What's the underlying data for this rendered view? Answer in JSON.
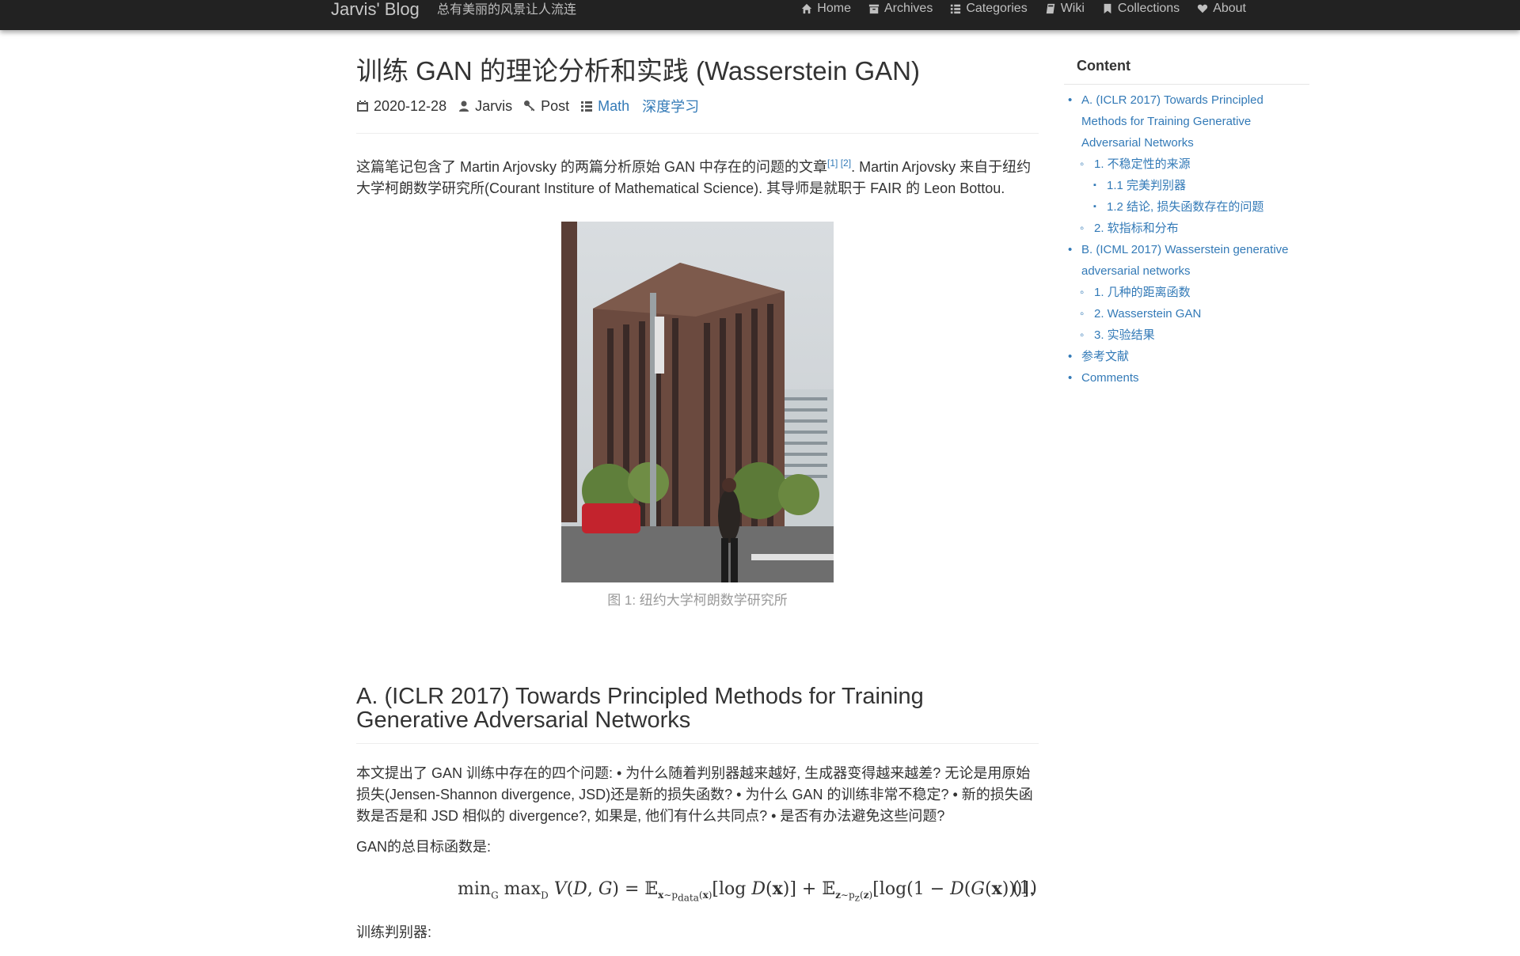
{
  "nav": {
    "brand": "Jarvis' Blog",
    "tagline": "总有美丽的风景让人流连",
    "items": [
      {
        "label": "Home",
        "icon": "home-icon"
      },
      {
        "label": "Archives",
        "icon": "archive-icon"
      },
      {
        "label": "Categories",
        "icon": "list-icon"
      },
      {
        "label": "Wiki",
        "icon": "book-icon"
      },
      {
        "label": "Collections",
        "icon": "bookmark-icon"
      },
      {
        "label": "About",
        "icon": "heart-icon"
      }
    ]
  },
  "post": {
    "title": "训练 GAN 的理论分析和实践 (Wasserstein GAN)",
    "date": "2020-12-28",
    "author": "Jarvis",
    "type": "Post",
    "categories": [
      "Math",
      "深度学习"
    ],
    "intro_text": "这篇笔记包含了 Martin Arjovsky 的两篇分析原始 GAN 中存在的问题的文章",
    "intro_refs": "[1] [2]",
    "intro_text_2": ". Martin Arjovsky 来自于纽约大学柯朗数学研究所(Courant Institure of Mathematical Science). 其导师是就职于 FAIR 的 Leon Bottou.",
    "figure_caption": "图 1: 纽约大学柯朗数学研究所",
    "section_a_title": "A. (ICLR 2017) Towards Principled Methods for Training Generative Adversarial Networks",
    "section_a_para": "本文提出了 GAN 训练中存在的四个问题: • 为什么随着判别器越来越好, 生成器变得越来越差? 无论是用原始损失(Jensen-Shannon divergence, JSD)还是新的损失函数? • 为什么 GAN 的训练非常不稳定? • 新的损失函数是否是和 JSD 相似的 divergence?, 如果是, 他们有什么共同点? • 是否有办法避免这些问题?",
    "objective_intro": "GAN的总目标函数是:",
    "equation_number": "(1)",
    "train_d": "训练判别器:"
  },
  "sidebar": {
    "title": "Content",
    "toc": [
      {
        "level": 1,
        "label": "A. (ICLR 2017) Towards Principled Methods for Training Generative Adversarial Networks"
      },
      {
        "level": 2,
        "label": "1. 不稳定性的来源"
      },
      {
        "level": 3,
        "label": "1.1 完美判别器"
      },
      {
        "level": 3,
        "label": "1.2 结论, 损失函数存在的问题"
      },
      {
        "level": 2,
        "label": "2. 软指标和分布"
      },
      {
        "level": 1,
        "label": "B. (ICML 2017) Wasserstein generative adversarial networks"
      },
      {
        "level": 2,
        "label": "1. 几种的距离函数"
      },
      {
        "level": 2,
        "label": "2. Wasserstein GAN"
      },
      {
        "level": 2,
        "label": "3. 实验结果"
      },
      {
        "level": 1,
        "label": "参考文献"
      },
      {
        "level": 1,
        "label": "Comments"
      }
    ]
  },
  "colors": {
    "navbar": "#222222",
    "link": "#337ab7",
    "text": "#333333",
    "caption": "#999999"
  }
}
